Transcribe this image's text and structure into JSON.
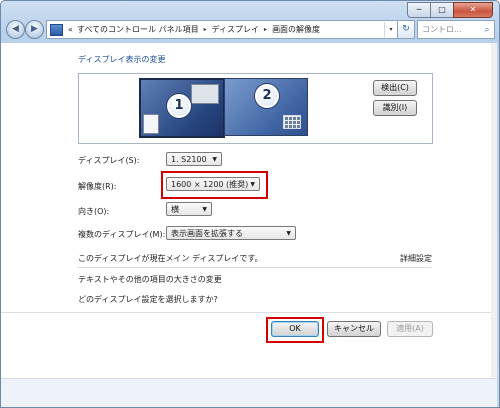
{
  "window": {
    "caption": {
      "minimize": "─",
      "maximize": "□",
      "close": "✕"
    }
  },
  "toolbar": {
    "back_icon": "back-arrow-icon",
    "forward_icon": "forward-arrow-icon",
    "breadcrumb": {
      "overflow": "«",
      "items": [
        "すべてのコントロール パネル項目",
        "ディスプレイ",
        "画面の解像度"
      ],
      "separator": "▸",
      "dropdown": "▾"
    },
    "refresh": "↻",
    "search_placeholder": "コントロ...",
    "search_icon": "⌕"
  },
  "main": {
    "heading": "ディスプレイ表示の変更",
    "monitors": [
      {
        "number": "1",
        "selected": true
      },
      {
        "number": "2",
        "selected": false
      }
    ],
    "detect_button": "検出(C)",
    "identify_button": "識別(I)",
    "display": {
      "label": "ディスプレイ(S):",
      "value": "1. S2100"
    },
    "resolution": {
      "label": "解像度(R):",
      "value": "1600 × 1200 (推奨)"
    },
    "orientation": {
      "label": "向き(O):",
      "value": "横"
    },
    "multiple_displays": {
      "label": "複数のディスプレイ(M):",
      "value": "表示画面を拡張する"
    },
    "status_text": "このディスプレイが現在メイン ディスプレイです。",
    "advanced_link": "詳細設定",
    "link_text_size": "テキストやその他の項目の大きさの変更",
    "link_which_settings": "どのディスプレイ設定を選択しますか?"
  },
  "dialog_buttons": {
    "ok": "OK",
    "cancel": "キャンセル",
    "apply": "適用(A)"
  },
  "colors": {
    "highlight": "#d40000",
    "link": "#1a5fb4"
  }
}
